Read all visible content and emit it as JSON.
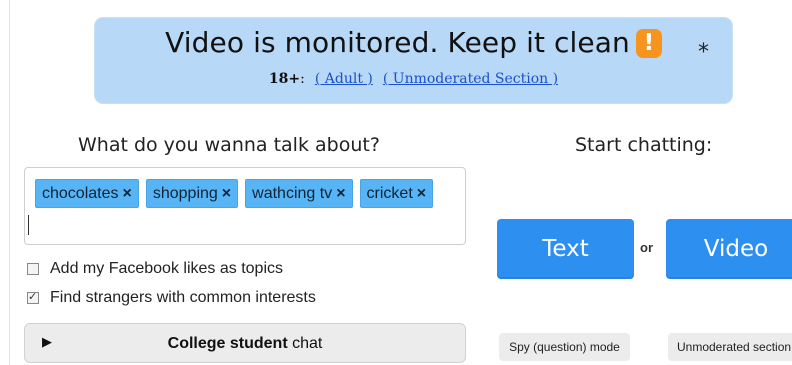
{
  "banner": {
    "title": "Video is monitored. Keep it clean",
    "warning_glyph": "!",
    "star_glyph": "*",
    "age_label": "18+",
    "age_suffix": ":",
    "adult_link": "( Adult )",
    "unmoderated_link": "( Unmoderated Section )"
  },
  "topics": {
    "heading": "What do you wanna talk about?",
    "remove_glyph": "×",
    "tags": [
      "chocolates",
      "shopping",
      "wathcing tv",
      "cricket"
    ]
  },
  "options": {
    "facebook_likes": {
      "label": "Add my Facebook likes as topics",
      "checked": false
    },
    "common_interests": {
      "label": "Find strangers with common interests",
      "checked": true
    }
  },
  "college": {
    "play_glyph": "▶",
    "bold_text": "College student",
    "rest_text": " chat"
  },
  "chat": {
    "heading": "Start chatting:",
    "text_button": "Text",
    "or_label": "or",
    "video_button": "Video",
    "spy_button": "Spy (question) mode",
    "unmoderated_button": "Unmoderated section"
  },
  "colors": {
    "banner_bg": "#b7d8f7",
    "accent_blue": "#2d8ff0",
    "tag_blue": "#57b5f5",
    "link_blue": "#1a4fd0",
    "warning_orange": "#f7941d"
  }
}
